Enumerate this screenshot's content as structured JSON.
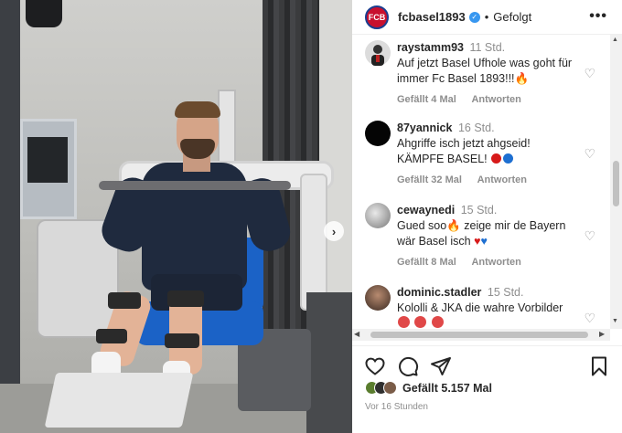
{
  "post": {
    "account": "fcbasel1893",
    "follow_state": "Gefolgt",
    "more": "•••",
    "separator": "•",
    "club_logo_text": "FCB"
  },
  "comments": [
    {
      "user": "raystamm93",
      "time": "11 Std.",
      "text": "Auf jetzt Basel Ufhole was goht für immer Fc Basel 1893!!!🔥",
      "likes": "Gefällt 4 Mal",
      "reply": "Antworten"
    },
    {
      "user": "87yannick",
      "time": "16 Std.",
      "text": "Ahgriffe isch jetzt ahgseid! KÄMPFE BASEL!",
      "likes": "Gefällt 32 Mal",
      "reply": "Antworten"
    },
    {
      "user": "cewaynedi",
      "time": "15 Std.",
      "text_1": "Gued soo🔥 zeige mir de Bayern",
      "text_2": "wär Basel isch",
      "likes": "Gefällt 8 Mal",
      "reply": "Antworten"
    },
    {
      "user": "dominic.stadler",
      "time": "15 Std.",
      "text": "Kololli & JKA die wahre Vorbilder"
    }
  ],
  "post_stats": {
    "likes_label": "Gefällt 5.157 Mal",
    "time_ago": "Vor 16 Stunden"
  },
  "icons": {
    "heart": "heart-icon",
    "comment": "comment-icon",
    "share": "send-icon",
    "save": "bookmark-icon"
  },
  "colors": {
    "club_red": "#c8102e",
    "club_blue": "#1a3d8f",
    "verified": "#3897f0",
    "meta_gray": "#8e8e8e"
  }
}
